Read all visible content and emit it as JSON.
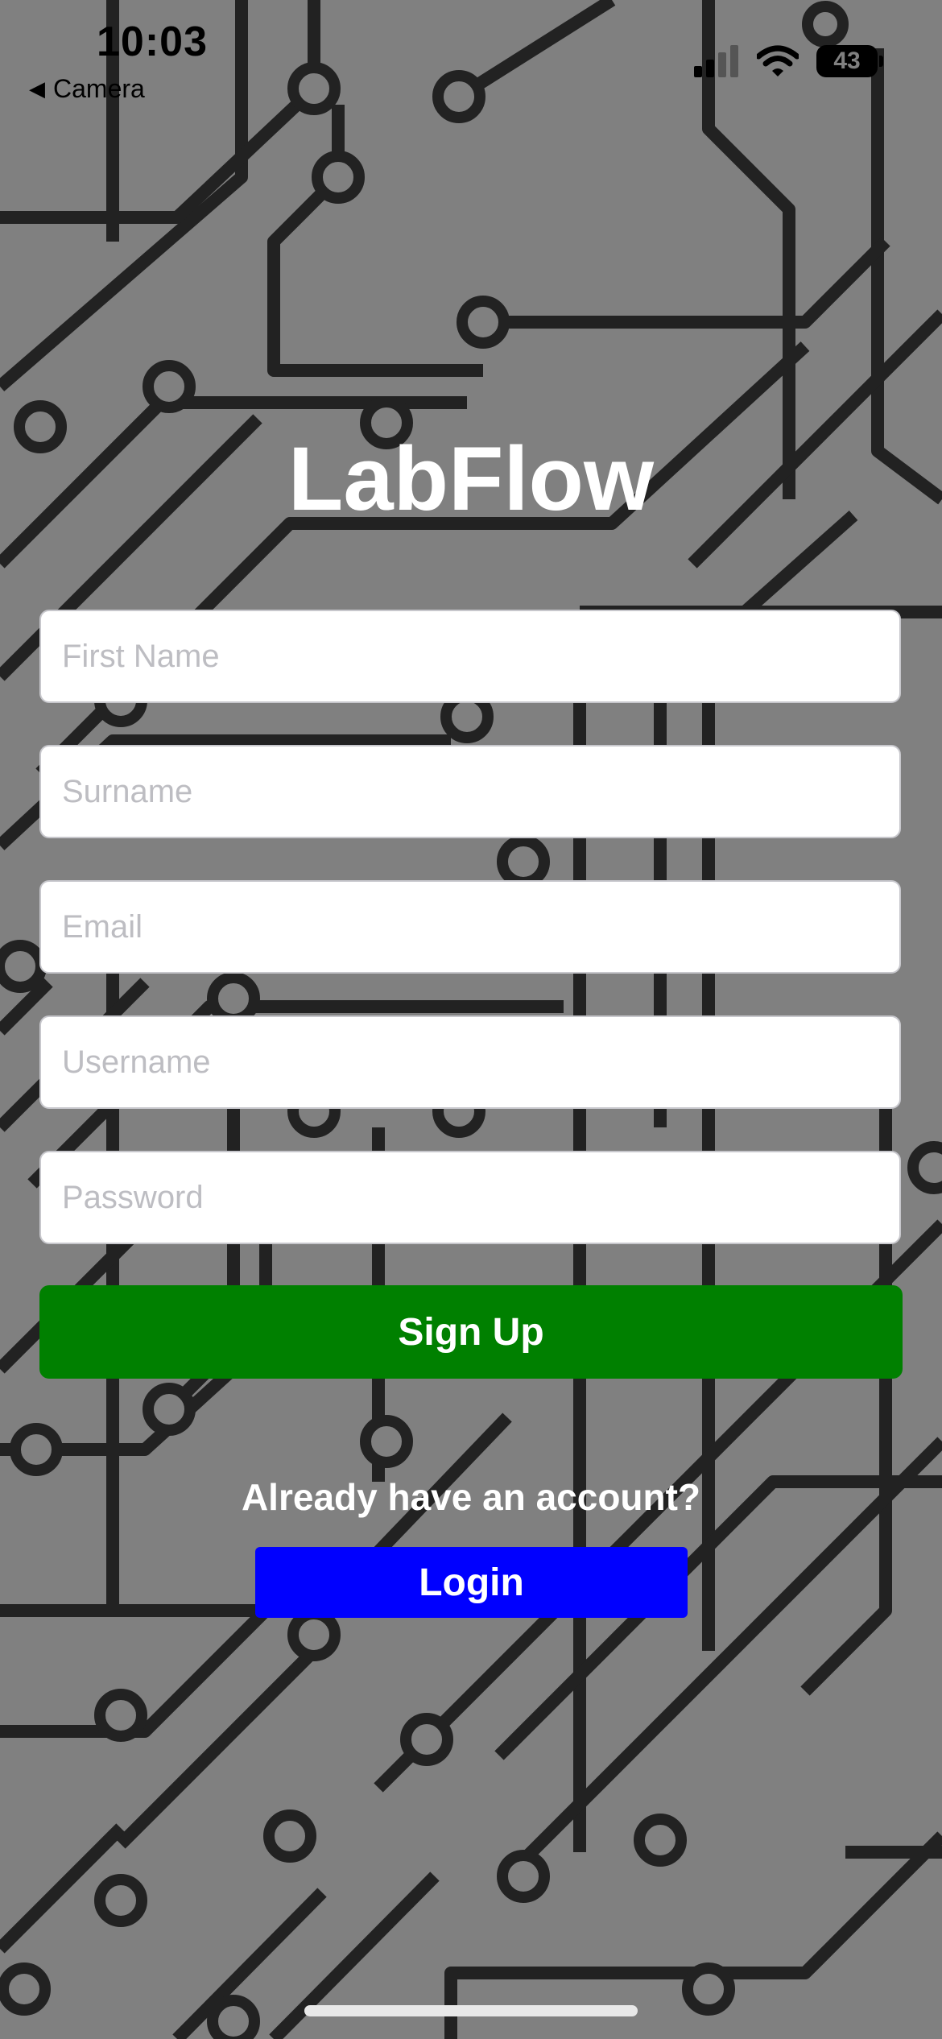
{
  "status_bar": {
    "time": "10:03",
    "back_label": "Camera",
    "battery": "43"
  },
  "app": {
    "title": "LabFlow"
  },
  "form": {
    "fields": [
      {
        "placeholder": "First Name",
        "value": ""
      },
      {
        "placeholder": "Surname",
        "value": ""
      },
      {
        "placeholder": "Email",
        "value": ""
      },
      {
        "placeholder": "Username",
        "value": ""
      },
      {
        "placeholder": "Password",
        "value": ""
      }
    ],
    "signup_label": "Sign Up"
  },
  "login": {
    "prompt": "Already have an account?",
    "button_label": "Login"
  },
  "colors": {
    "background": "#808080",
    "signup_button": "#008000",
    "login_button": "#0000ff",
    "title": "#ffffff"
  }
}
